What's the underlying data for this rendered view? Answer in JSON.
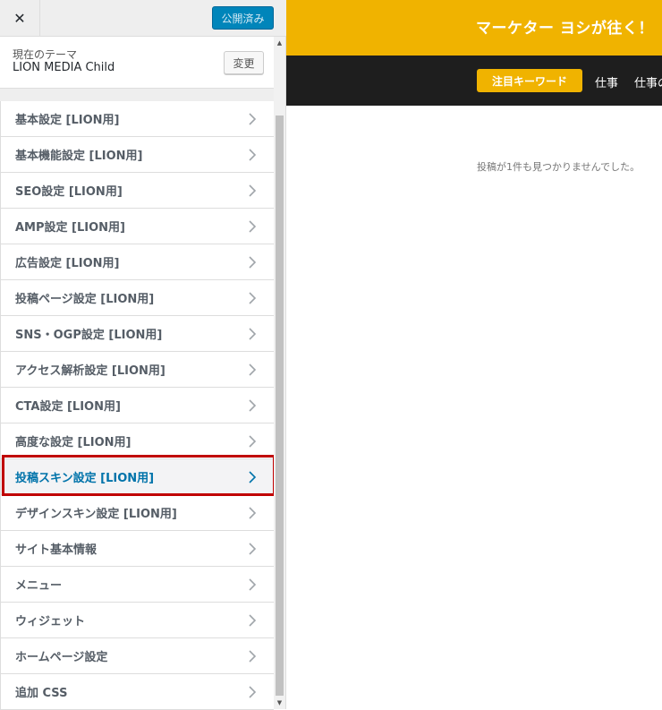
{
  "topbar": {
    "close_symbol": "✕",
    "publish_label": "公開済み"
  },
  "theme": {
    "label": "現在のテーマ",
    "name": "LION MEDIA Child",
    "change_label": "変更"
  },
  "menu": [
    {
      "label": "基本設定 [LION用]"
    },
    {
      "label": "基本機能設定 [LION用]"
    },
    {
      "label": "SEO設定 [LION用]"
    },
    {
      "label": "AMP設定 [LION用]"
    },
    {
      "label": "広告設定 [LION用]"
    },
    {
      "label": "投稿ページ設定 [LION用]"
    },
    {
      "label": "SNS・OGP設定 [LION用]"
    },
    {
      "label": "アクセス解析設定 [LION用]"
    },
    {
      "label": "CTA設定 [LION用]"
    },
    {
      "label": "高度な設定 [LION用]"
    },
    {
      "label": "投稿スキン設定 [LION用]",
      "active": true
    },
    {
      "label": "デザインスキン設定 [LION用]"
    },
    {
      "label": "サイト基本情報"
    },
    {
      "label": "メニュー"
    },
    {
      "label": "ウィジェット"
    },
    {
      "label": "ホームページ設定"
    },
    {
      "label": "追加 CSS"
    }
  ],
  "preview": {
    "site_title": "マーケター ヨシが往く！",
    "nav_pill": "注目キーワード",
    "nav_link_1": "仕事",
    "nav_link_2": "仕事の",
    "empty_message": "投稿が1件も見つかりませんでした。"
  },
  "colors": {
    "publish": "#0085ba",
    "site_header": "#f0b300",
    "nav_bar": "#1e1e1e",
    "highlight_border": "#c00000",
    "active_text": "#0073aa"
  }
}
